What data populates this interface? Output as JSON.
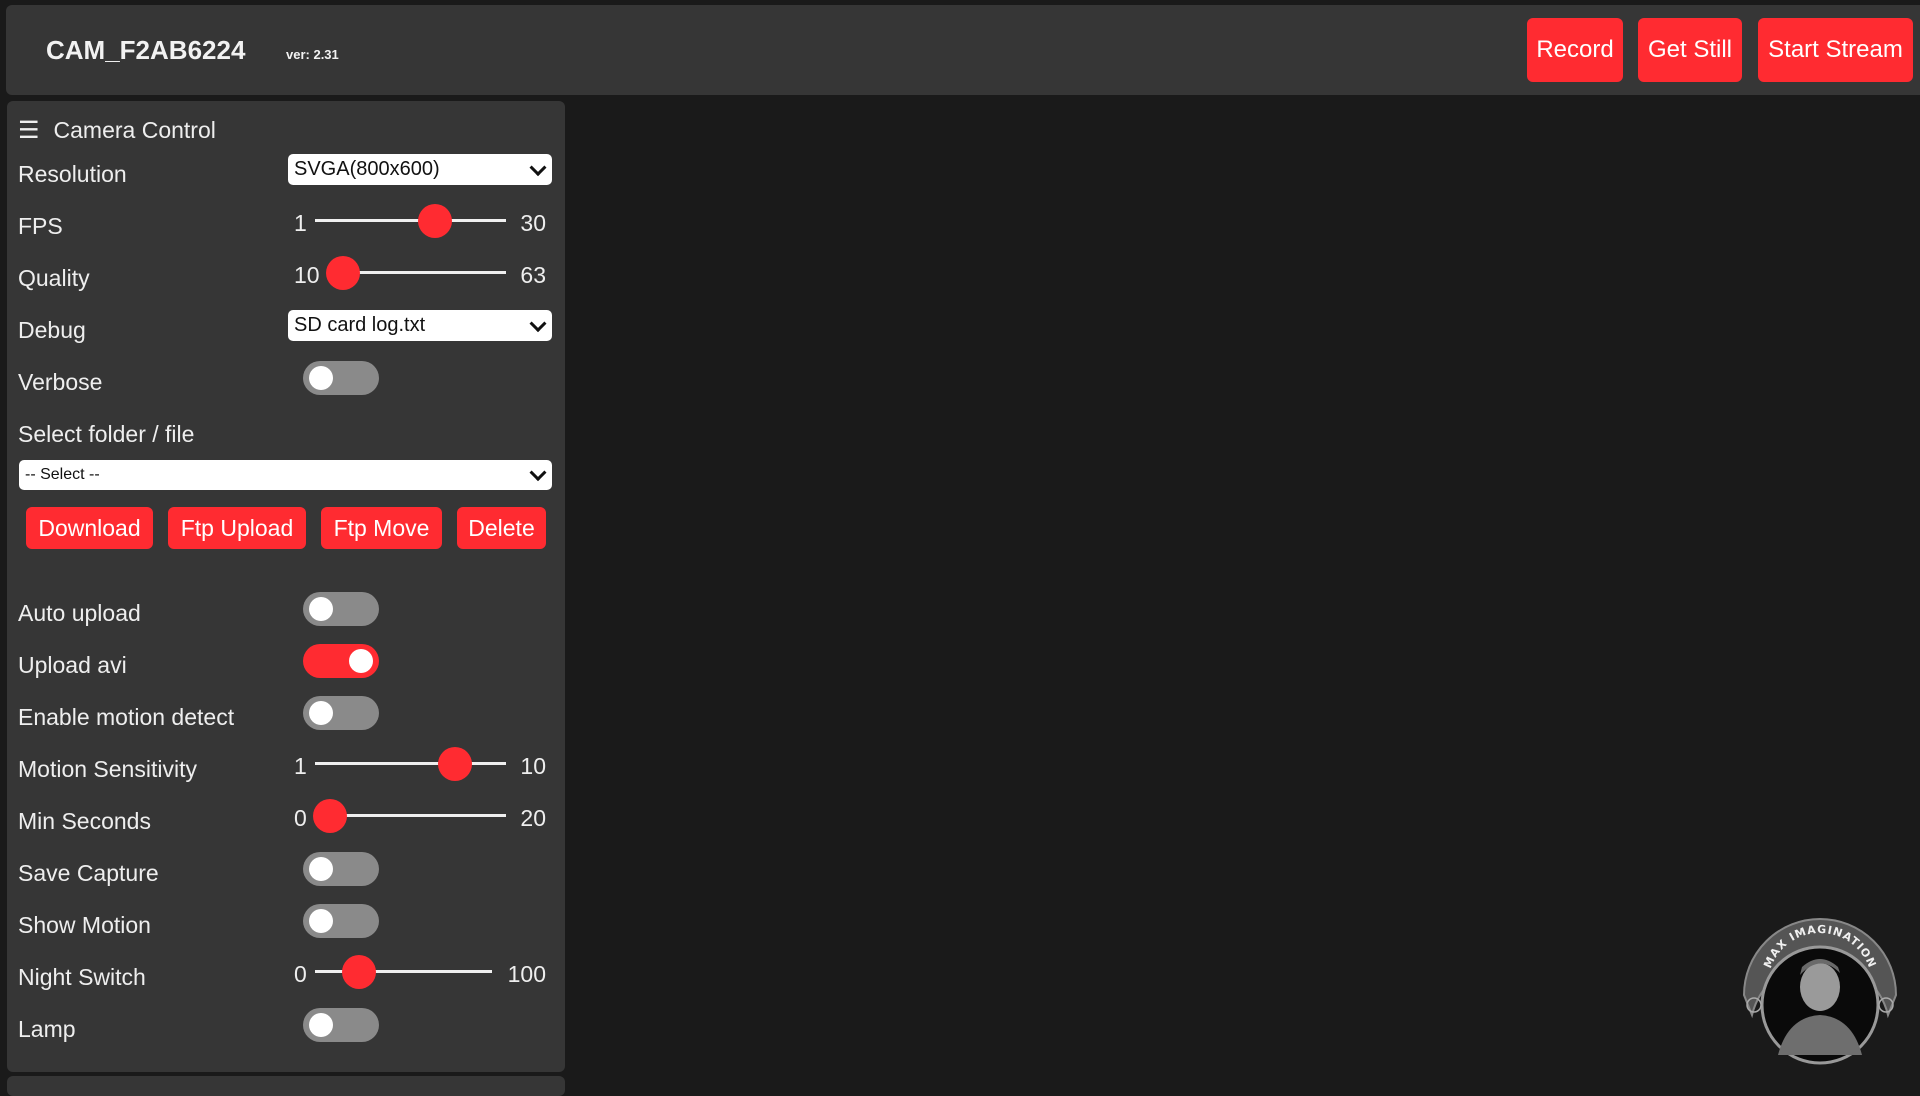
{
  "header": {
    "title": "CAM_F2AB6224",
    "version": "ver: 2.31",
    "buttons": [
      {
        "label": "Record"
      },
      {
        "label": "Get Still"
      },
      {
        "label": "Start Stream"
      }
    ]
  },
  "colors": {
    "accent": "#ff2b31",
    "panel": "#363636",
    "background": "#1a1a1a",
    "toggle_off": "#8a8a8a"
  },
  "sidebar": {
    "title": "Camera Control",
    "menu_icon": "hamburger-menu-icon",
    "resolution": {
      "label": "Resolution",
      "value": "SVGA(800x600)"
    },
    "fps": {
      "label": "FPS",
      "min": "1",
      "max": "30",
      "value": 20
    },
    "quality": {
      "label": "Quality",
      "min": "10",
      "max": "63",
      "value": 10
    },
    "debug": {
      "label": "Debug",
      "value": "SD card log.txt"
    },
    "verbose": {
      "label": "Verbose",
      "on": false
    },
    "folder": {
      "label": "Select folder / file",
      "value": "-- Select --"
    },
    "actions": [
      {
        "label": "Download"
      },
      {
        "label": "Ftp Upload"
      },
      {
        "label": "Ftp Move"
      },
      {
        "label": "Delete"
      }
    ],
    "auto_upload": {
      "label": "Auto upload",
      "on": false
    },
    "upload_avi": {
      "label": "Upload avi",
      "on": true
    },
    "motion_detect": {
      "label": "Enable motion detect",
      "on": false
    },
    "motion_sensitivity": {
      "label": "Motion Sensitivity",
      "min": "1",
      "max": "10",
      "value": 8
    },
    "min_seconds": {
      "label": "Min Seconds",
      "min": "0",
      "max": "20",
      "value": 0
    },
    "save_capture": {
      "label": "Save Capture",
      "on": false
    },
    "show_motion": {
      "label": "Show Motion",
      "on": false
    },
    "night_switch": {
      "label": "Night Switch",
      "min": "0",
      "max": "100",
      "value": 20
    },
    "lamp": {
      "label": "Lamp",
      "on": false
    }
  },
  "logo": {
    "text": "MAX IMAGINATION"
  }
}
